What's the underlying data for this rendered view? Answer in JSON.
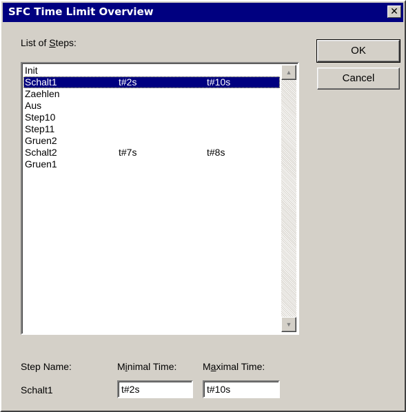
{
  "window": {
    "title": "SFC Time Limit Overview",
    "close_glyph": "✕"
  },
  "list_label": {
    "prefix": "List of ",
    "accel": "S",
    "suffix": "teps:"
  },
  "steps": [
    {
      "name": "Init",
      "min": "",
      "max": ""
    },
    {
      "name": "Schalt1",
      "min": "t#2s",
      "max": "t#10s",
      "selected": true
    },
    {
      "name": "Zaehlen",
      "min": "",
      "max": ""
    },
    {
      "name": "Aus",
      "min": "",
      "max": ""
    },
    {
      "name": "Step10",
      "min": "",
      "max": ""
    },
    {
      "name": "Step11",
      "min": "",
      "max": ""
    },
    {
      "name": "Gruen2",
      "min": "",
      "max": ""
    },
    {
      "name": "Schalt2",
      "min": "t#7s",
      "max": "t#8s"
    },
    {
      "name": "Gruen1",
      "min": "",
      "max": ""
    }
  ],
  "buttons": {
    "ok": "OK",
    "cancel": "Cancel"
  },
  "fields": {
    "step_name_label": "Step Name:",
    "min_label": {
      "prefix": "M",
      "accel": "i",
      "suffix": "nimal Time:"
    },
    "max_label": {
      "prefix": "M",
      "accel": "a",
      "suffix": "ximal Time:"
    },
    "step_name_value": "Schalt1",
    "min_value": "t#2s",
    "max_value": "t#10s"
  },
  "icons": {
    "scroll_up": "scroll-up-arrow-icon",
    "scroll_down": "scroll-down-arrow-icon"
  }
}
